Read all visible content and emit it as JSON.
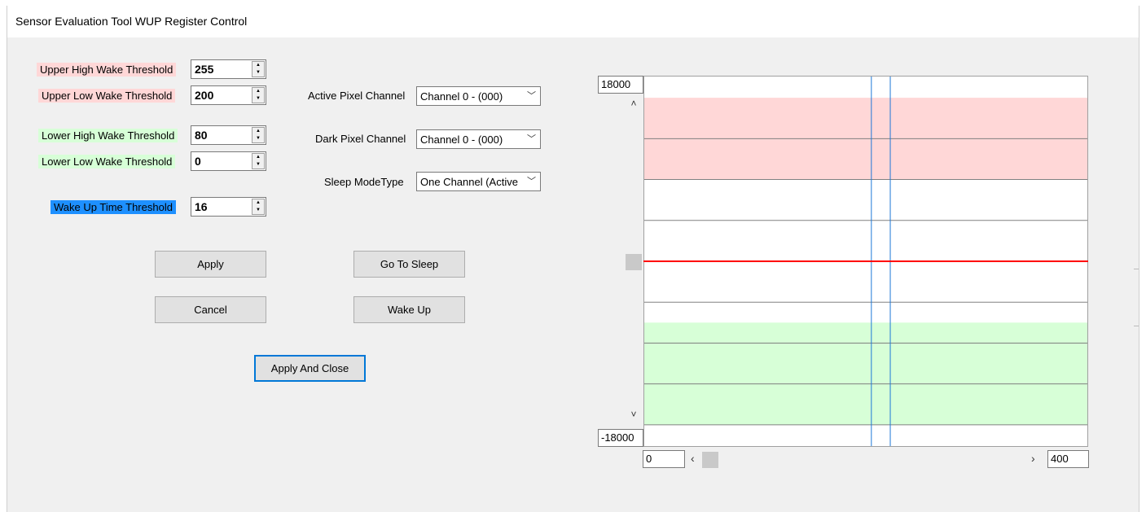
{
  "window": {
    "title": "Sensor Evaluation Tool WUP Register Control"
  },
  "thresholds": {
    "upper_high": {
      "label": "Upper High Wake Threshold",
      "value": "255"
    },
    "upper_low": {
      "label": "Upper Low Wake Threshold",
      "value": "200"
    },
    "lower_high": {
      "label": "Lower High Wake Threshold",
      "value": "80"
    },
    "lower_low": {
      "label": "Lower Low Wake Threshold",
      "value": "0"
    },
    "wake_up_time": {
      "label": "Wake Up Time Threshold",
      "value": "16"
    }
  },
  "settings": {
    "active_pixel": {
      "label": "Active Pixel Channel",
      "value": "Channel 0  - (000)"
    },
    "dark_pixel": {
      "label": "Dark Pixel Channel",
      "value": "Channel 0  - (000)"
    },
    "sleep_mode": {
      "label": "Sleep ModeType",
      "value": "One Channel (Active"
    }
  },
  "buttons": {
    "apply": "Apply",
    "cancel": "Cancel",
    "go_to_sleep": "Go To Sleep",
    "wake_up": "Wake Up",
    "apply_and_close": "Apply And Close"
  },
  "chart": {
    "y_max": "18000",
    "y_min": "-18000",
    "x_min": "0",
    "x_max": "400"
  },
  "chart_data": {
    "type": "line",
    "ylim": [
      -18000,
      18000
    ],
    "xlim": [
      0,
      400
    ],
    "bands": [
      {
        "name": "upper",
        "from": 8000,
        "to": 16000,
        "color": "#ffd7d7"
      },
      {
        "name": "lower",
        "from": -16000,
        "to": -6000,
        "color": "#d7ffd7"
      }
    ],
    "gridlines_y": [
      12000,
      8000,
      4000,
      0,
      -4000,
      -8000,
      -12000,
      -16000
    ],
    "cursor_lines_x": [
      205,
      222
    ],
    "series": [
      {
        "color": "#ff0000",
        "x": [
          0,
          400
        ],
        "y": [
          0,
          0
        ]
      }
    ]
  }
}
